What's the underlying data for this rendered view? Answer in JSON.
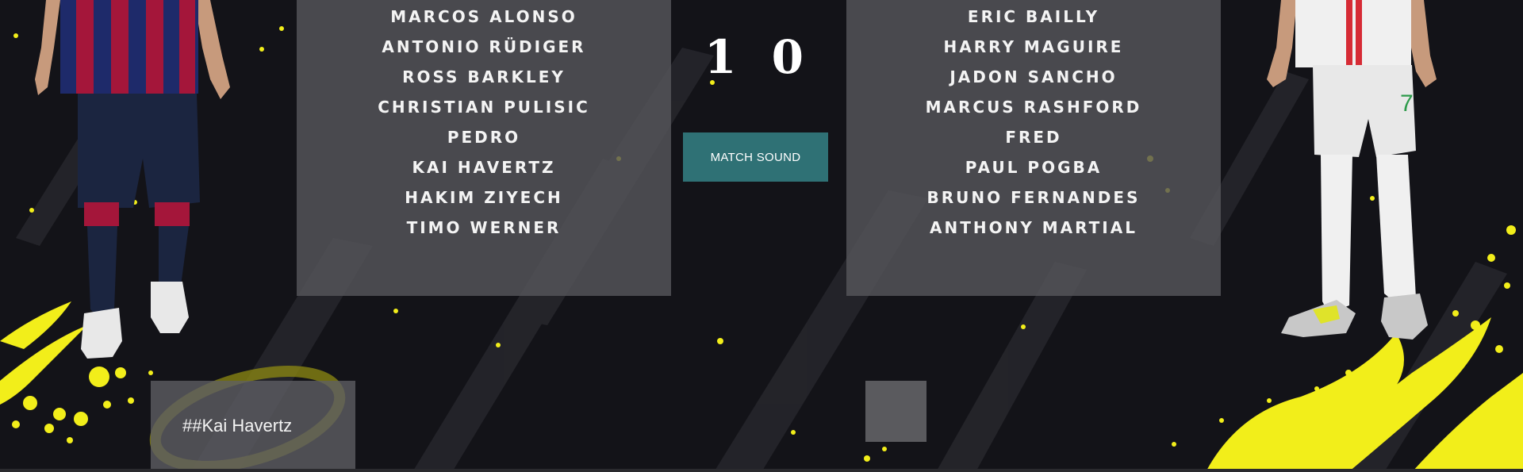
{
  "home_team": {
    "players": [
      "MARCOS ALONSO",
      "ANTONIO RÜDIGER",
      "ROSS BARKLEY",
      "CHRISTIAN PULISIC",
      "PEDRO",
      "KAI HAVERTZ",
      "HAKIM ZIYECH",
      "TIMO WERNER"
    ]
  },
  "away_team": {
    "players": [
      "ERIC BAILLY",
      "HARRY MAGUIRE",
      "JADON SANCHO",
      "MARCUS RASHFORD",
      "FRED",
      "PAUL POGBA",
      "BRUNO FERNANDES",
      "ANTHONY MARTIAL"
    ]
  },
  "score": {
    "display": "1 0"
  },
  "controls": {
    "match_sound_label": "MATCH SOUND"
  },
  "chat": {
    "message": "##Kai Havertz"
  },
  "colors": {
    "background": "#131318",
    "accent_yellow": "#f2ee1a",
    "button": "#2f7175",
    "panel": "#55555a"
  }
}
